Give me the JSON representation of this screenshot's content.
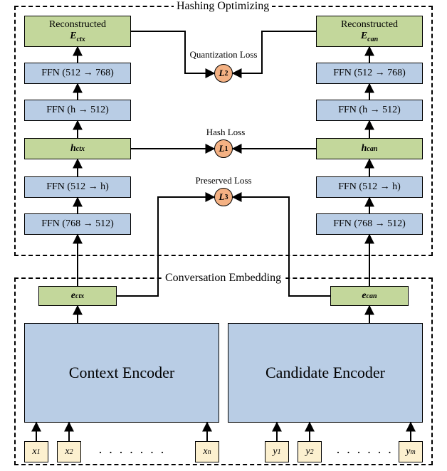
{
  "diagram": {
    "sections": {
      "top_title": "Hashing Optimizing",
      "bottom_title": "Conversation Embedding"
    },
    "losses": {
      "l1": {
        "name": "L",
        "idx": "1",
        "caption": "Hash Loss"
      },
      "l2": {
        "name": "L",
        "idx": "2",
        "caption": "Quantization Loss"
      },
      "l3": {
        "name": "L",
        "idx": "3",
        "caption": "Preserved Loss"
      }
    },
    "left": {
      "reconstructed_lbl": "Reconstructed",
      "reconstructed_sym": "E",
      "reconstructed_sub": "ctx",
      "ffn_up2": "FFN (512 → 768)",
      "ffn_up1": "FFN (h → 512)",
      "h_sym": "h",
      "h_sub": "ctx",
      "ffn_dn2": "FFN (512 → h)",
      "ffn_dn1": "FFN (768 → 512)",
      "e_sym": "e",
      "e_sub": "ctx",
      "encoder": "Context Encoder",
      "inputs": {
        "x1": "x",
        "x1s": "1",
        "x2": "x",
        "x2s": "2",
        "xn": "x",
        "xns": "n"
      }
    },
    "right": {
      "reconstructed_lbl": "Reconstructed",
      "reconstructed_sym": "E",
      "reconstructed_sub": "can",
      "ffn_up2": "FFN (512 → 768)",
      "ffn_up1": "FFN (h → 512)",
      "h_sym": "h",
      "h_sub": "can",
      "ffn_dn2": "FFN (512 → h)",
      "ffn_dn1": "FFN (768 → 512)",
      "e_sym": "e",
      "e_sub": "can",
      "encoder": "Candidate Encoder",
      "inputs": {
        "y1": "y",
        "y1s": "1",
        "y2": "y",
        "y2s": "2",
        "ym": "y",
        "yms": "m"
      }
    },
    "dots": "· · · · · · ·"
  }
}
